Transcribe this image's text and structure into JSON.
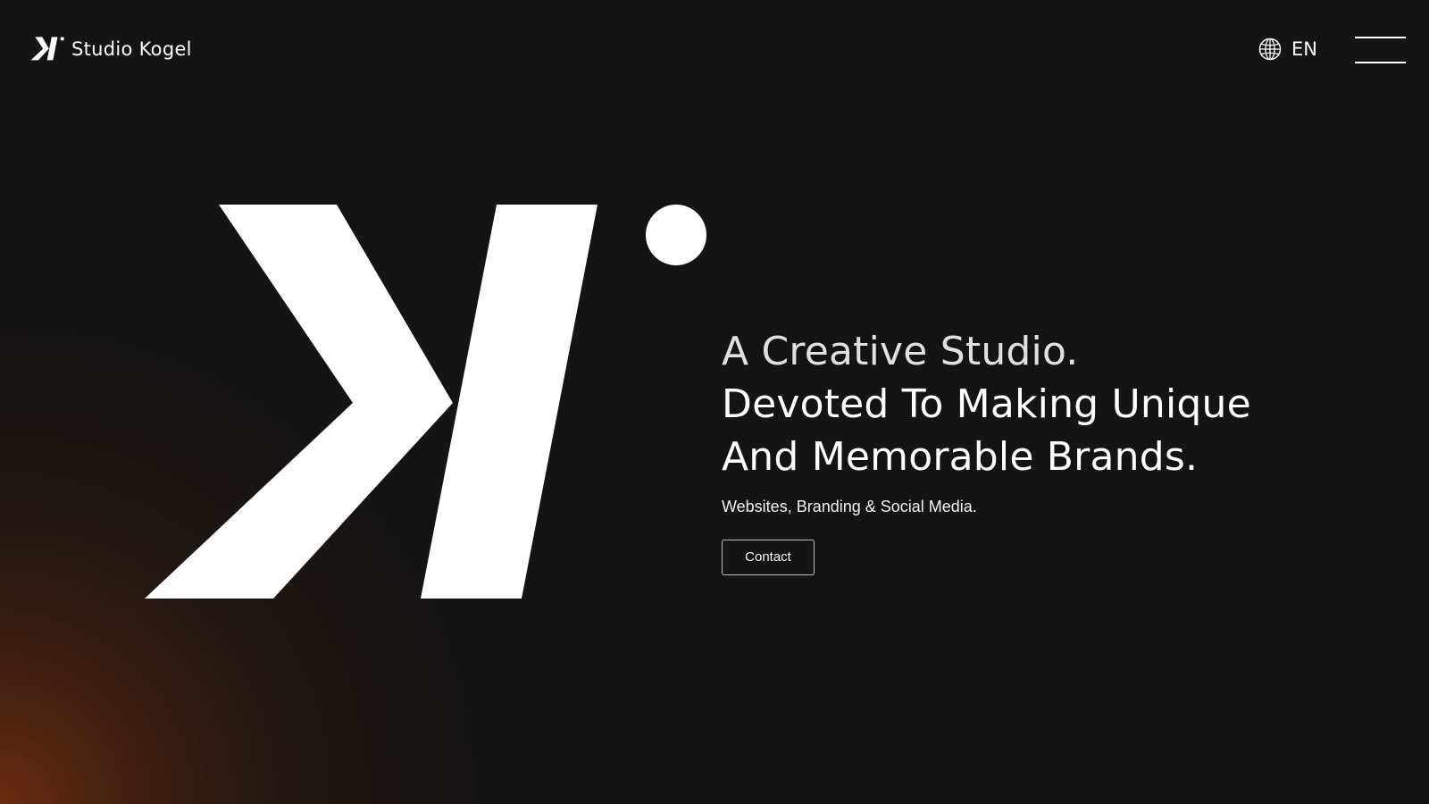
{
  "header": {
    "brand_name": "Studio Kogel",
    "language": "EN",
    "icons": {
      "logo": "studio-kogel-logo",
      "language": "globe-icon",
      "menu": "hamburger-menu-icon"
    }
  },
  "hero": {
    "headline": [
      "A Creative Studio.",
      "Devoted To Making Unique",
      "And Memorable Brands."
    ],
    "subtitle": "Websites, Branding & Social Media.",
    "contact_label": "Contact"
  },
  "colors": {
    "background": "#141414",
    "foreground": "#ffffff",
    "glow": "#6e2d0f"
  }
}
